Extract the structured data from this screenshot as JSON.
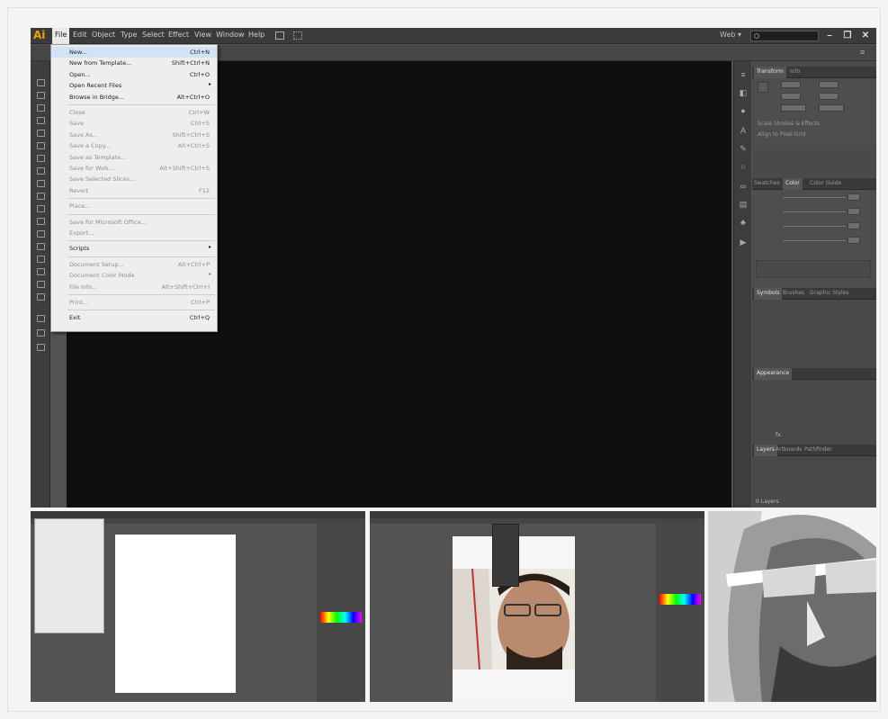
{
  "app": {
    "logo": "Ai",
    "menus": [
      "File",
      "Edit",
      "Object",
      "Type",
      "Select",
      "Effect",
      "View",
      "Window",
      "Help"
    ],
    "active_menu": "File",
    "workspace": "Web",
    "workspace_arrow": "▾",
    "window_controls": [
      "–",
      "❐",
      "✕"
    ]
  },
  "file_menu": {
    "items": [
      {
        "label": "New...",
        "shortcut": "Ctrl+N",
        "disabled": false,
        "highlight": true
      },
      {
        "label": "New from Template...",
        "shortcut": "Shift+Ctrl+N",
        "disabled": false
      },
      {
        "label": "Open...",
        "shortcut": "Ctrl+O",
        "disabled": false
      },
      {
        "label": "Open Recent Files",
        "shortcut": "",
        "disabled": false,
        "submenu": true
      },
      {
        "label": "Browse in Bridge...",
        "shortcut": "Alt+Ctrl+O",
        "disabled": false
      },
      {
        "label": "Close",
        "shortcut": "Ctrl+W",
        "disabled": true
      },
      {
        "label": "Save",
        "shortcut": "Ctrl+S",
        "disabled": true
      },
      {
        "label": "Save As...",
        "shortcut": "Shift+Ctrl+S",
        "disabled": true
      },
      {
        "label": "Save a Copy...",
        "shortcut": "Alt+Ctrl+S",
        "disabled": true
      },
      {
        "label": "Save as Template...",
        "shortcut": "",
        "disabled": true
      },
      {
        "label": "Save for Web...",
        "shortcut": "Alt+Shift+Ctrl+S",
        "disabled": true
      },
      {
        "label": "Save Selected Slices...",
        "shortcut": "",
        "disabled": true
      },
      {
        "label": "Revert",
        "shortcut": "F12",
        "disabled": true
      },
      {
        "label": "Place...",
        "shortcut": "",
        "disabled": true
      },
      {
        "label": "Save for Microsoft Office...",
        "shortcut": "",
        "disabled": true
      },
      {
        "label": "Export...",
        "shortcut": "",
        "disabled": true
      },
      {
        "label": "Scripts",
        "shortcut": "",
        "disabled": false,
        "submenu": true
      },
      {
        "label": "Document Setup...",
        "shortcut": "Alt+Ctrl+P",
        "disabled": true
      },
      {
        "label": "Document Color Mode",
        "shortcut": "",
        "disabled": true,
        "submenu": true
      },
      {
        "label": "File Info...",
        "shortcut": "Alt+Shift+Ctrl+I",
        "disabled": true
      },
      {
        "label": "Print...",
        "shortcut": "Ctrl+P",
        "disabled": true
      },
      {
        "label": "Exit",
        "shortcut": "Ctrl+Q",
        "disabled": false
      }
    ]
  },
  "panels": {
    "transform_tabs": [
      "Transform",
      "Info"
    ],
    "transform_checks": [
      "Scale Strokes & Effects",
      "Align to Pixel Grid"
    ],
    "color_tabs": [
      "Swatches",
      "Color",
      "Color Guide"
    ],
    "symbols_tabs": [
      "Symbols",
      "Brushes",
      "Graphic Styles"
    ],
    "appearance_tabs": [
      "Appearance"
    ],
    "layers_tabs": [
      "Layers",
      "Artboards",
      "Pathfinder"
    ],
    "layers_footer": "0 Layers",
    "fx_label": "fx."
  },
  "colors": {
    "accent": "#f2a000",
    "canvas": "#0f0f0f",
    "ui_dark": "#535353",
    "menu_bg": "#eeeeee",
    "highlight": "#d3e3f6"
  }
}
